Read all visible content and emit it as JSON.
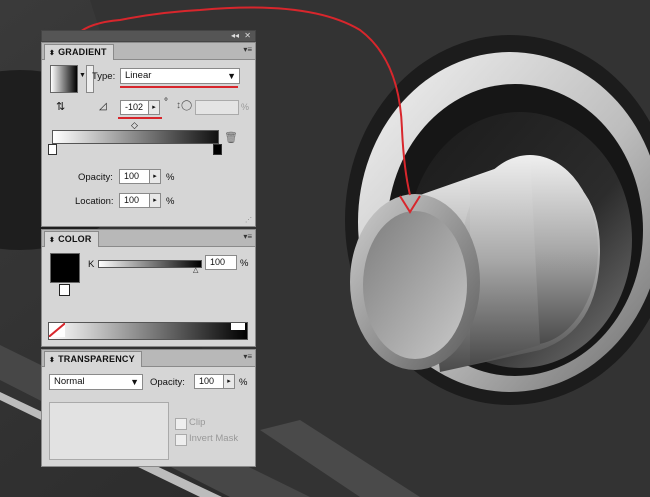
{
  "gradient_panel": {
    "tab_label": "GRADIENT",
    "type_label": "Type:",
    "type_value": "Linear",
    "angle_value": "-102",
    "degree_symbol": "°",
    "aspect_percent": "%",
    "opacity_label": "Opacity:",
    "opacity_value": "100",
    "opacity_unit": "%",
    "location_label": "Location:",
    "location_value": "100",
    "location_unit": "%"
  },
  "color_panel": {
    "tab_label": "COLOR",
    "channel_label": "K",
    "channel_value": "100",
    "channel_unit": "%"
  },
  "transparency_panel": {
    "tab_label": "TRANSPARENCY",
    "blend_mode": "Normal",
    "opacity_label": "Opacity:",
    "opacity_value": "100",
    "opacity_unit": "%",
    "clip_label": "Clip",
    "invert_mask_label": "Invert Mask"
  },
  "icons": {
    "collapse": "double-chevron-left-icon",
    "close": "close-icon",
    "panel_menu": "panel-menu-icon",
    "reverse": "reverse-gradient-icon",
    "angle": "angle-icon",
    "aspect": "aspect-ratio-icon",
    "trash": "trash-icon",
    "spin": "triangle-right-icon"
  },
  "colors": {
    "panel_bg": "#d6d6d6",
    "annotation": "#d8262c",
    "swatch_black": "#000000"
  }
}
